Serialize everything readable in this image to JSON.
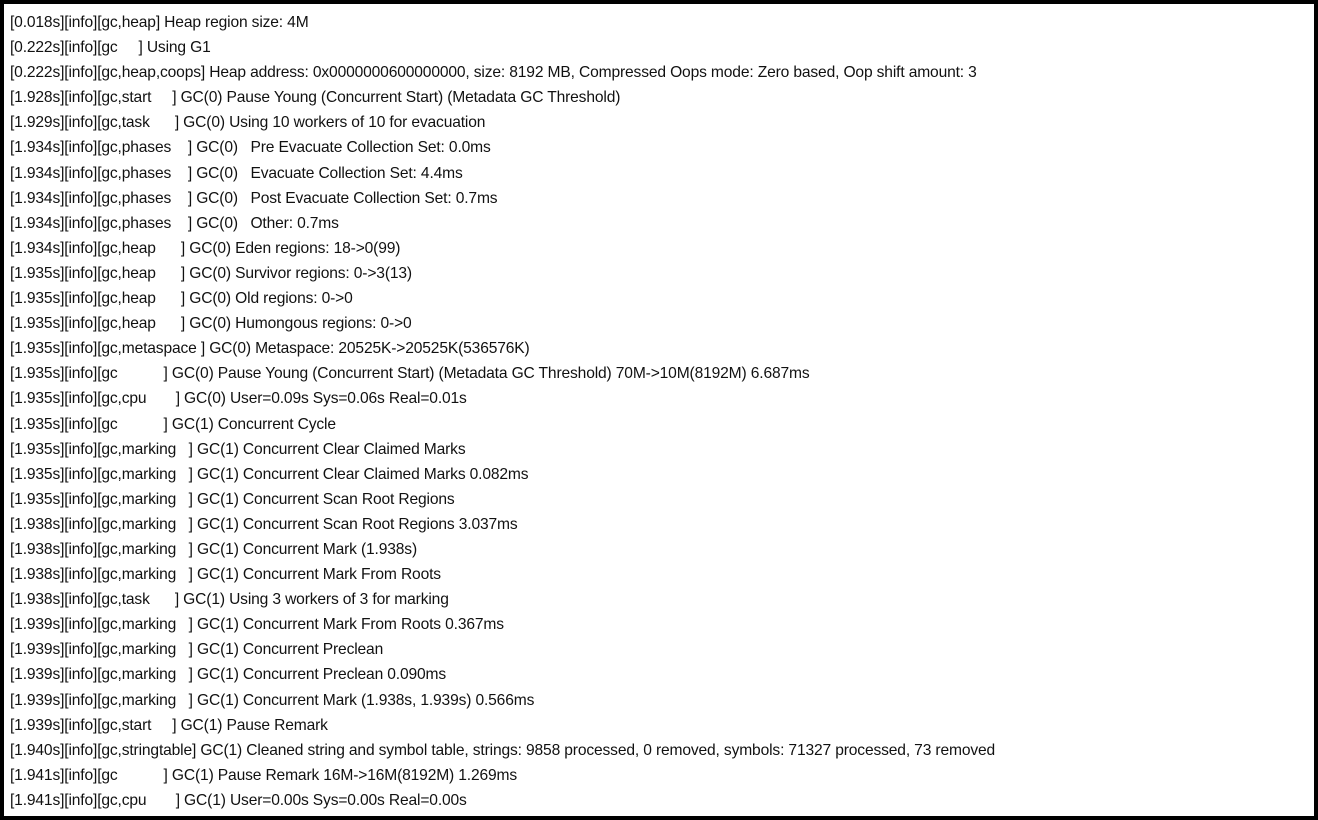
{
  "log": {
    "lines": [
      "[0.018s][info][gc,heap] Heap region size: 4M",
      "[0.222s][info][gc     ] Using G1",
      "[0.222s][info][gc,heap,coops] Heap address: 0x0000000600000000, size: 8192 MB, Compressed Oops mode: Zero based, Oop shift amount: 3",
      "[1.928s][info][gc,start     ] GC(0) Pause Young (Concurrent Start) (Metadata GC Threshold)",
      "[1.929s][info][gc,task      ] GC(0) Using 10 workers of 10 for evacuation",
      "[1.934s][info][gc,phases    ] GC(0)   Pre Evacuate Collection Set: 0.0ms",
      "[1.934s][info][gc,phases    ] GC(0)   Evacuate Collection Set: 4.4ms",
      "[1.934s][info][gc,phases    ] GC(0)   Post Evacuate Collection Set: 0.7ms",
      "[1.934s][info][gc,phases    ] GC(0)   Other: 0.7ms",
      "[1.934s][info][gc,heap      ] GC(0) Eden regions: 18->0(99)",
      "[1.935s][info][gc,heap      ] GC(0) Survivor regions: 0->3(13)",
      "[1.935s][info][gc,heap      ] GC(0) Old regions: 0->0",
      "[1.935s][info][gc,heap      ] GC(0) Humongous regions: 0->0",
      "[1.935s][info][gc,metaspace ] GC(0) Metaspace: 20525K->20525K(536576K)",
      "[1.935s][info][gc           ] GC(0) Pause Young (Concurrent Start) (Metadata GC Threshold) 70M->10M(8192M) 6.687ms",
      "[1.935s][info][gc,cpu       ] GC(0) User=0.09s Sys=0.06s Real=0.01s",
      "[1.935s][info][gc           ] GC(1) Concurrent Cycle",
      "[1.935s][info][gc,marking   ] GC(1) Concurrent Clear Claimed Marks",
      "[1.935s][info][gc,marking   ] GC(1) Concurrent Clear Claimed Marks 0.082ms",
      "[1.935s][info][gc,marking   ] GC(1) Concurrent Scan Root Regions",
      "[1.938s][info][gc,marking   ] GC(1) Concurrent Scan Root Regions 3.037ms",
      "[1.938s][info][gc,marking   ] GC(1) Concurrent Mark (1.938s)",
      "[1.938s][info][gc,marking   ] GC(1) Concurrent Mark From Roots",
      "[1.938s][info][gc,task      ] GC(1) Using 3 workers of 3 for marking",
      "[1.939s][info][gc,marking   ] GC(1) Concurrent Mark From Roots 0.367ms",
      "[1.939s][info][gc,marking   ] GC(1) Concurrent Preclean",
      "[1.939s][info][gc,marking   ] GC(1) Concurrent Preclean 0.090ms",
      "[1.939s][info][gc,marking   ] GC(1) Concurrent Mark (1.938s, 1.939s) 0.566ms",
      "[1.939s][info][gc,start     ] GC(1) Pause Remark",
      "[1.940s][info][gc,stringtable] GC(1) Cleaned string and symbol table, strings: 9858 processed, 0 removed, symbols: 71327 processed, 73 removed",
      "[1.941s][info][gc           ] GC(1) Pause Remark 16M->16M(8192M) 1.269ms",
      "[1.941s][info][gc,cpu       ] GC(1) User=0.00s Sys=0.00s Real=0.00s"
    ]
  }
}
